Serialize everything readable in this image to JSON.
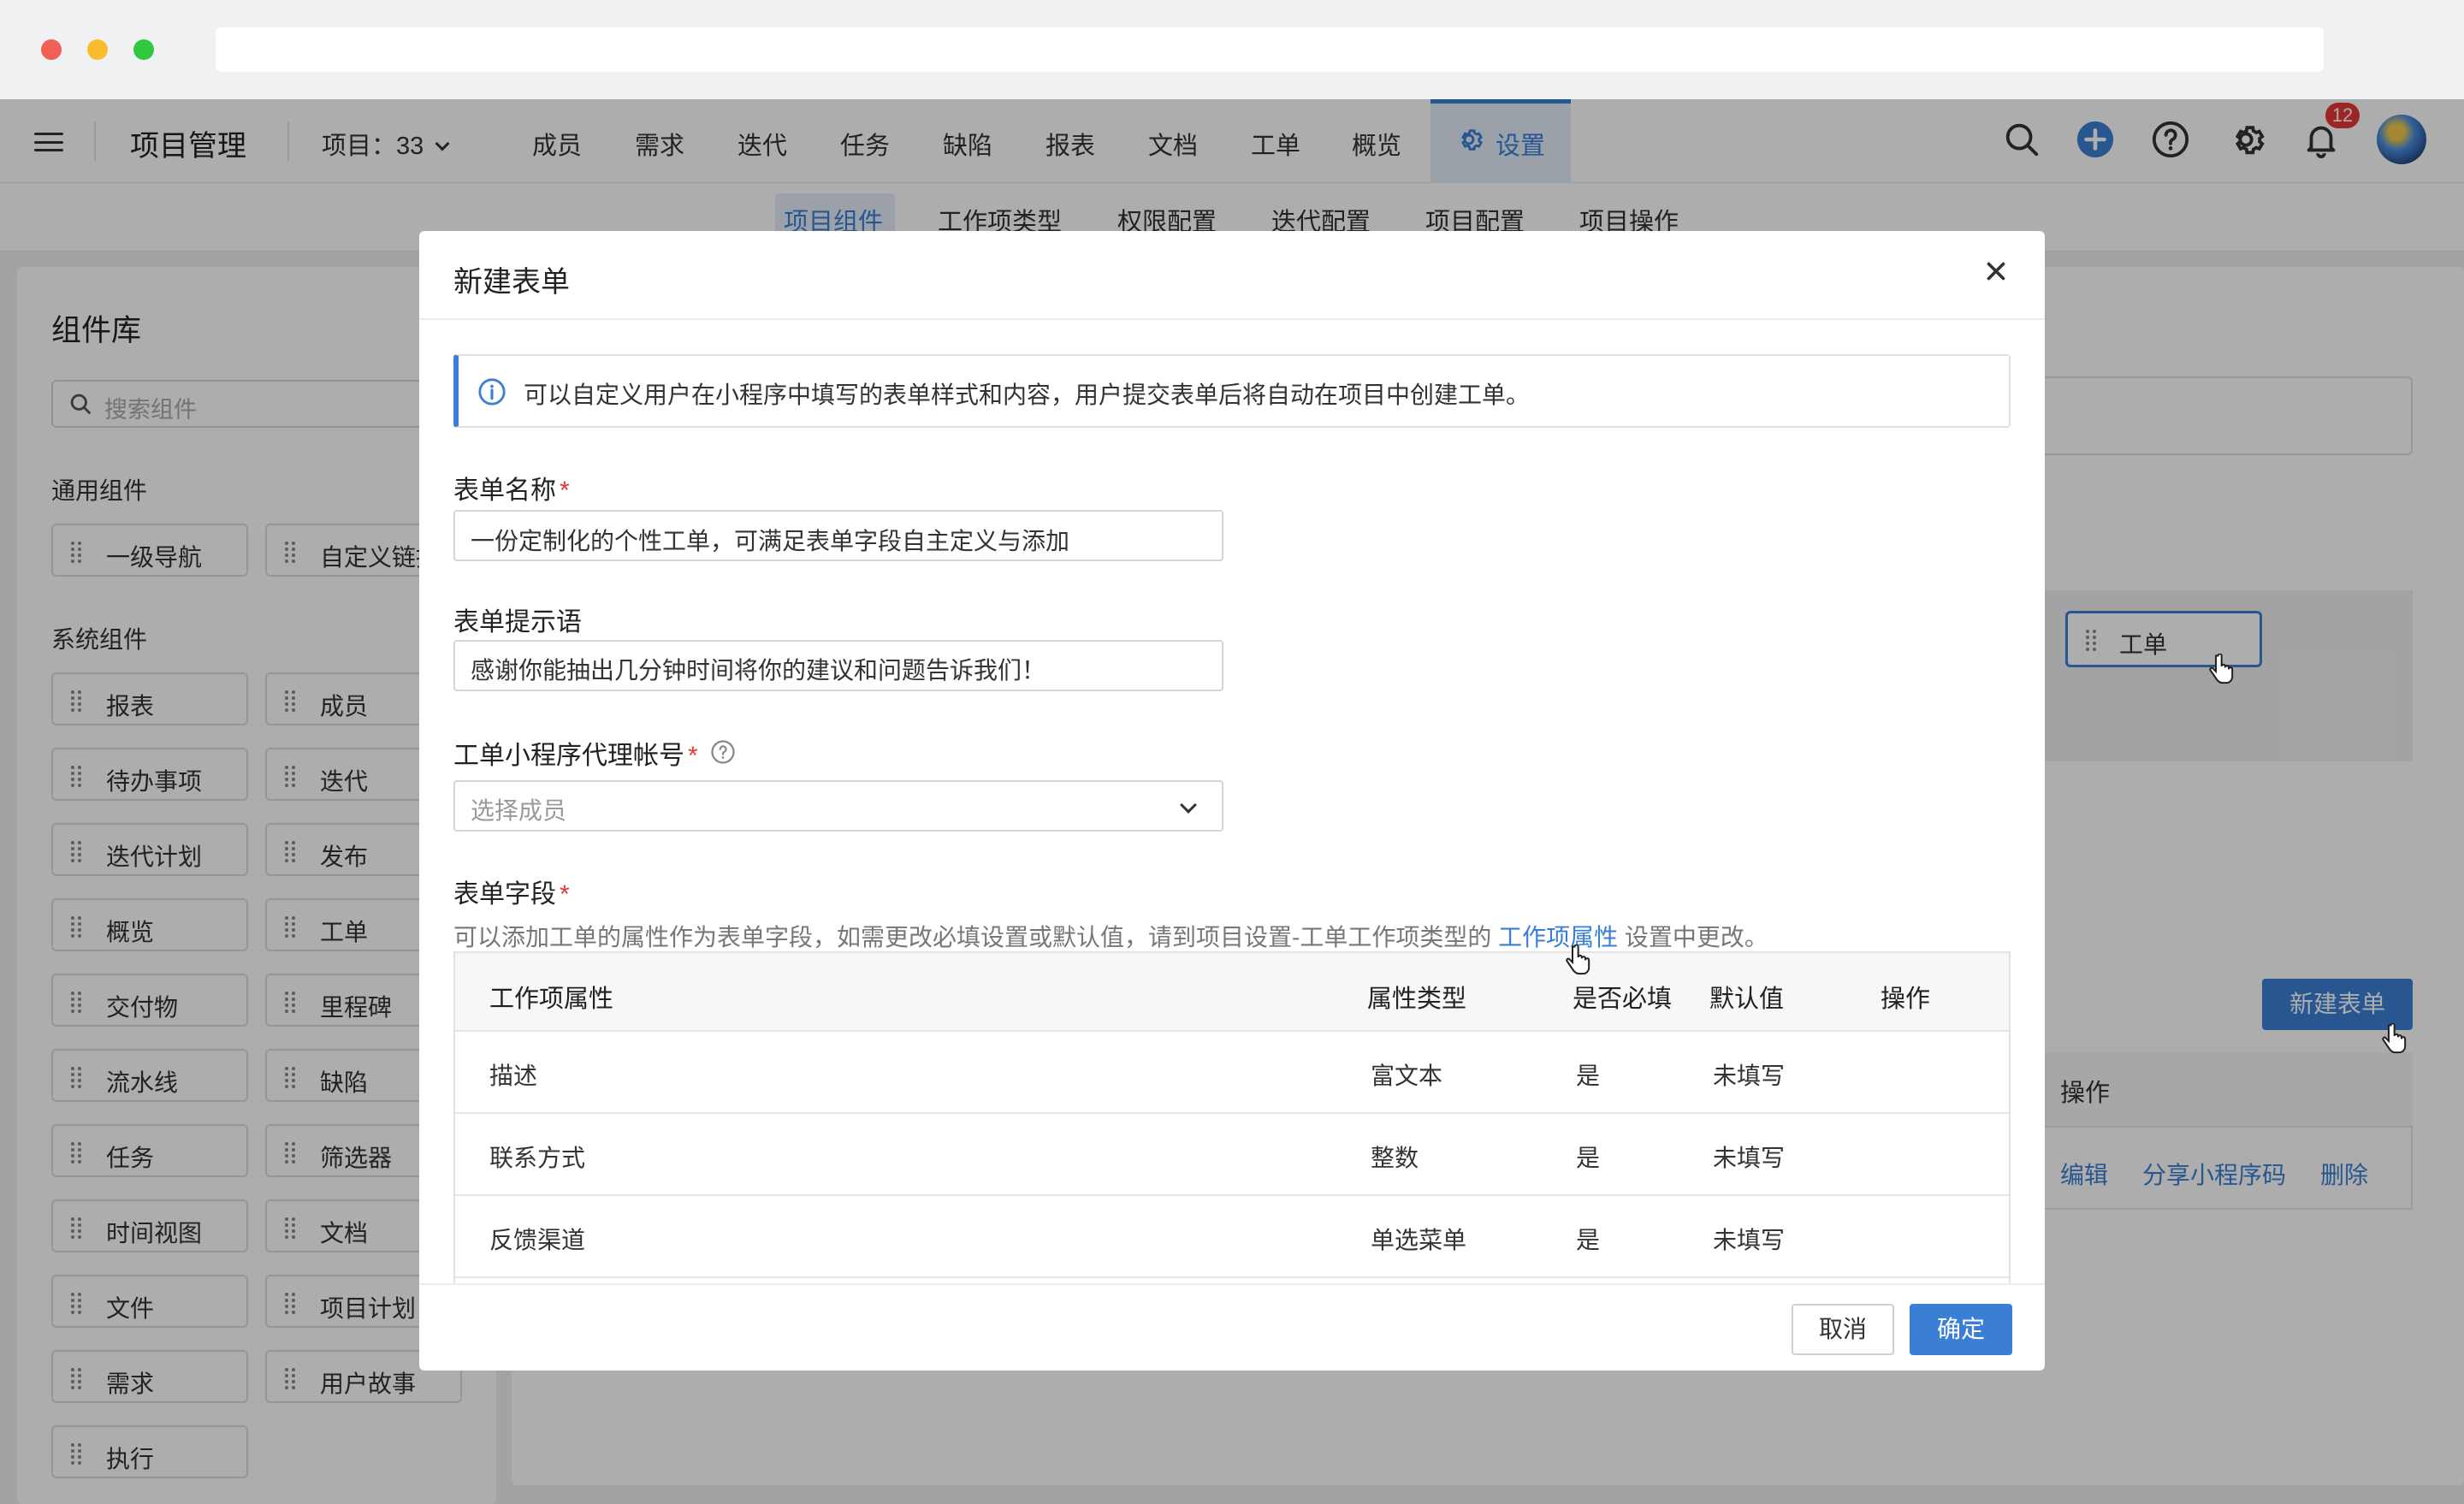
{
  "header": {
    "app_title": "项目管理",
    "project_select": "项目：33",
    "nav": [
      "成员",
      "需求",
      "迭代",
      "任务",
      "缺陷",
      "报表",
      "文档",
      "工单",
      "概览"
    ],
    "active_nav": "设置",
    "notification_count": "12"
  },
  "subnav": [
    "项目组件",
    "工作项类型",
    "权限配置",
    "迭代配置",
    "项目配置",
    "项目操作"
  ],
  "left_panel": {
    "title": "组件库",
    "search_placeholder": "搜索组件",
    "general_title": "通用组件",
    "general_items": [
      "一级导航",
      "自定义链接"
    ],
    "system_title": "系统组件",
    "system_items": [
      [
        "报表",
        "成员"
      ],
      [
        "待办事项",
        "迭代"
      ],
      [
        "迭代计划",
        "发布"
      ],
      [
        "概览",
        "工单"
      ],
      [
        "交付物",
        "里程碑"
      ],
      [
        "流水线",
        "缺陷"
      ],
      [
        "任务",
        "筛选器"
      ],
      [
        "时间视图",
        "文档"
      ],
      [
        "文件",
        "项目计划"
      ],
      [
        "需求",
        "用户故事"
      ],
      [
        "执行"
      ]
    ]
  },
  "background": {
    "work_order_chip": "工单",
    "new_form_button": "新建表单",
    "op_header": "操作",
    "links": [
      "编辑",
      "分享小程序码",
      "删除"
    ]
  },
  "modal": {
    "title": "新建表单",
    "info": "可以自定义用户在小程序中填写的表单样式和内容，用户提交表单后将自动在项目中创建工单。",
    "form_name_label": "表单名称",
    "form_name_value": "一份定制化的个性工单，可满足表单字段自主定义与添加",
    "form_hint_label": "表单提示语",
    "form_hint_value": "感谢你能抽出几分钟时间将你的建议和问题告诉我们！",
    "agent_label": "工单小程序代理帐号",
    "agent_placeholder": "选择成员",
    "fields_label": "表单字段",
    "fields_desc_pre": "可以添加工单的属性作为表单字段，如需更改必填设置或默认值，请到项目设置-工单工作项类型的",
    "fields_desc_link": "工作项属性",
    "fields_desc_post": "设置中更改。",
    "table": {
      "headers": [
        "工作项属性",
        "属性类型",
        "是否必填",
        "默认值",
        "操作"
      ],
      "rows": [
        [
          "描述",
          "富文本",
          "是",
          "未填写"
        ],
        [
          "联系方式",
          "整数",
          "是",
          "未填写"
        ],
        [
          "反馈渠道",
          "单选菜单",
          "是",
          "未填写"
        ]
      ]
    },
    "cancel": "取消",
    "confirm": "确定"
  },
  "colors": {
    "accent": "#3a7fd5",
    "required": "#e53935",
    "badge": "#e53935"
  }
}
